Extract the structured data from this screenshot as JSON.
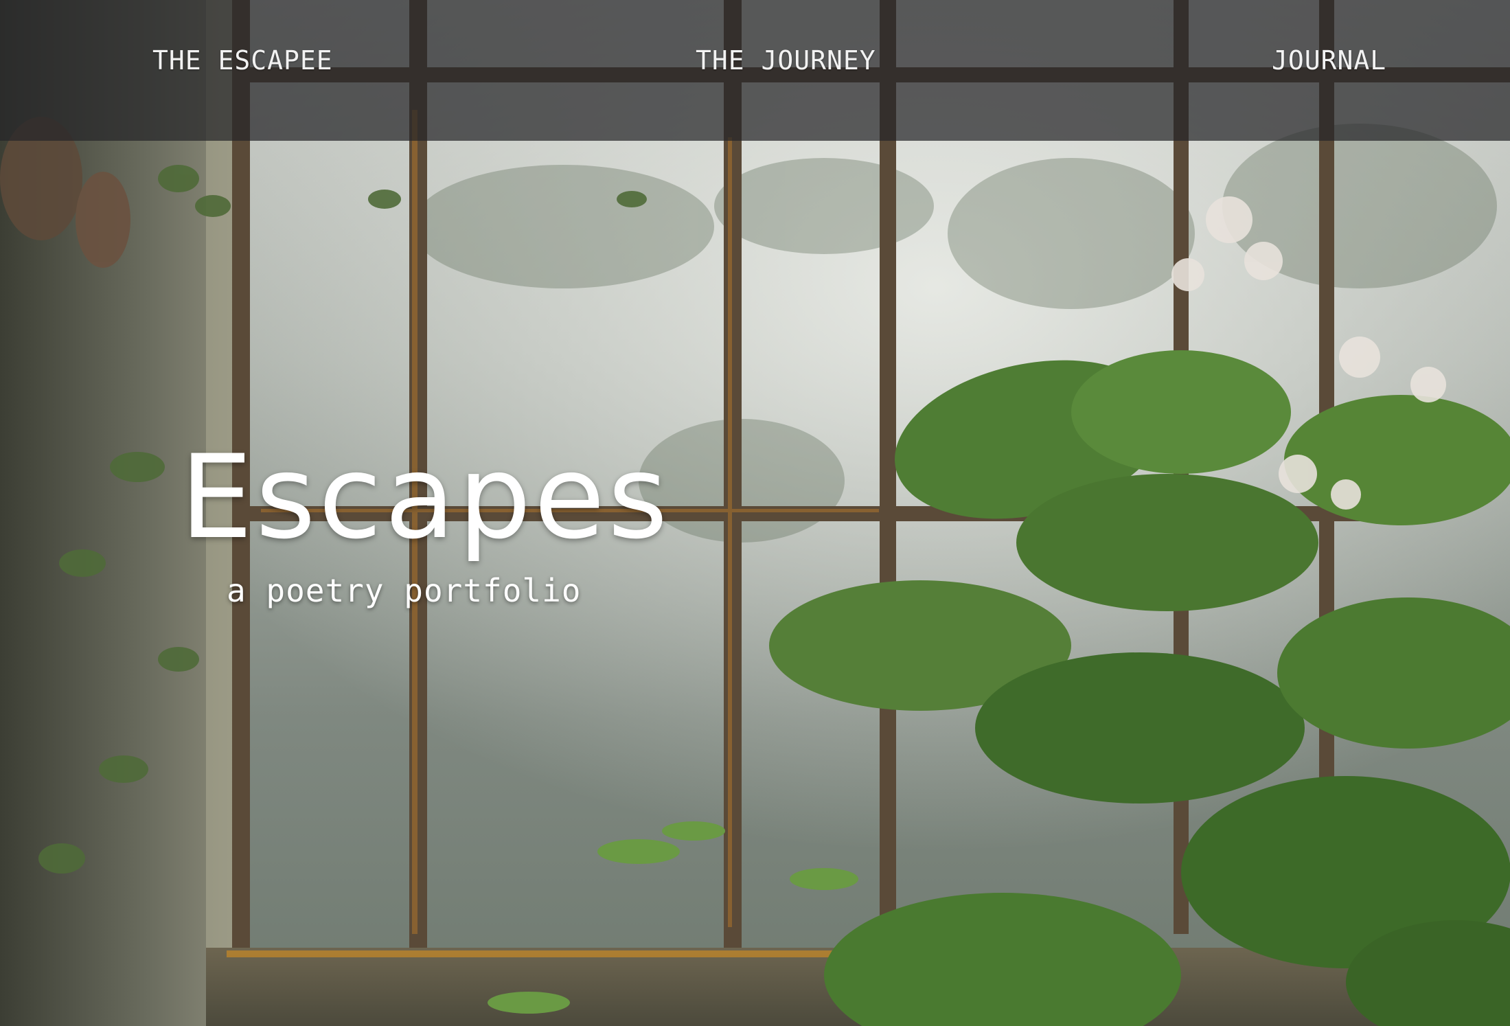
{
  "nav": {
    "escapee": "THE ESCAPEE",
    "journey": "THE JOURNEY",
    "journal": "JOURNAL"
  },
  "hero": {
    "title": "Escapes",
    "subtitle": "a poetry portfolio"
  },
  "colors": {
    "topbar": "#262628",
    "text": "#ffffff",
    "window_frame": "#5a4a38",
    "foliage": "#4f7d34"
  }
}
